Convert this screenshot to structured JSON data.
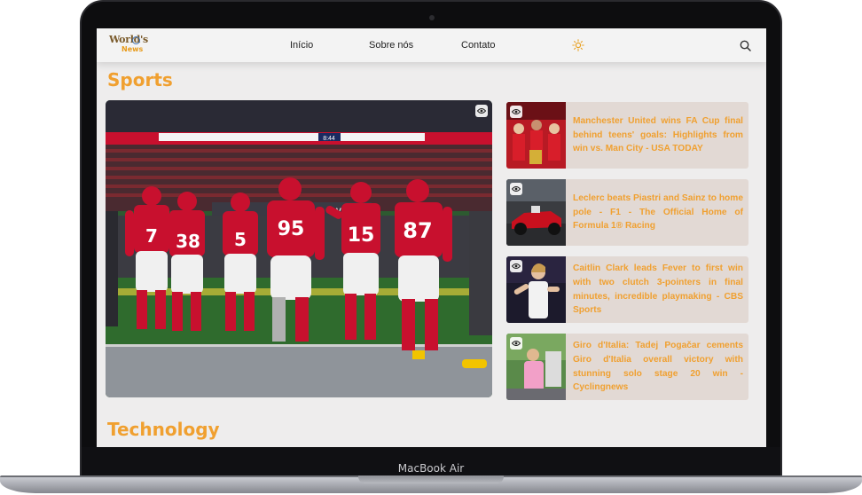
{
  "device": {
    "label": "MacBook Air"
  },
  "navbar": {
    "logo": {
      "line1": "World's",
      "line2": "News"
    },
    "links": [
      "Início",
      "Sobre nós",
      "Contato"
    ],
    "theme_icon": "sun-icon",
    "search_icon": "search-icon"
  },
  "sections": {
    "sports": {
      "title": "Sports",
      "cards": [
        {
          "title": "Manchester United wins FA Cup final behind teens' goals: Highlights from win vs. Man City - USA TODAY",
          "icon": "eye-icon"
        },
        {
          "title": "Leclerc beats Piastri and Sainz to home pole - F1 - The Official Home of Formula 1® Racing",
          "icon": "eye-icon"
        },
        {
          "title": "Caitlin Clark leads Fever to first win with two clutch 3-pointers in final minutes, incredible playmaking - CBS Sports",
          "icon": "eye-icon"
        },
        {
          "title": "Giro d'Italia: Tadej Pogačar cements Giro d'Italia overall victory with stunning solo stage 20 win - Cyclingnews",
          "icon": "eye-icon"
        }
      ],
      "hero_image": {
        "jersey_numbers": [
          "7",
          "38",
          "5",
          "95",
          "15",
          "87"
        ],
        "scoreboard": "8:44",
        "banner": "LVIII"
      }
    },
    "technology": {
      "title": "Technology"
    }
  },
  "colors": {
    "accent": "#f0a030",
    "card_bg": "#e2d9d4",
    "page_bg": "#eeeded",
    "jersey_red": "#c8102e"
  }
}
